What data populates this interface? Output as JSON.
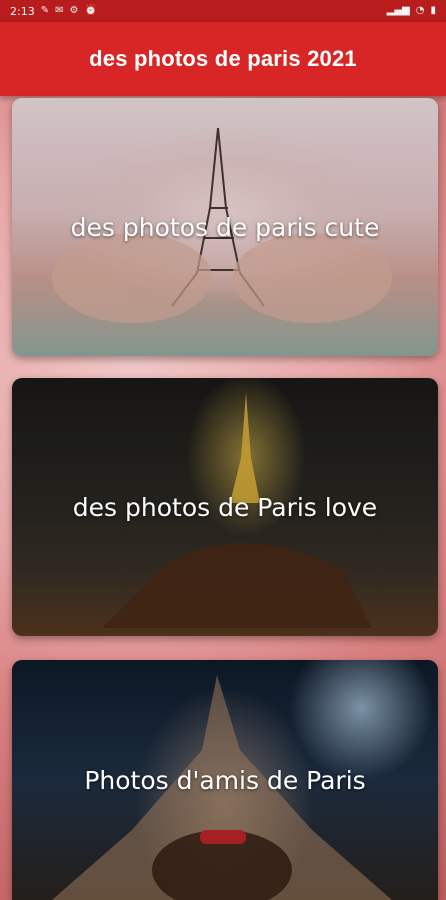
{
  "status_bar": {
    "time": "2:13",
    "left_icons": [
      "notification-icon",
      "mail-icon",
      "settings-icon",
      "alarm-icon"
    ],
    "right_icons": [
      "signal-icon",
      "wifi-icon",
      "battery-icon"
    ]
  },
  "app_bar": {
    "title": "des photos de paris 2021"
  },
  "cards": [
    {
      "label": "des photos de paris cute",
      "image": "eiffel-tower-in-hands-photo"
    },
    {
      "label": "des photos de Paris love",
      "image": "eiffel-tower-night-photo"
    },
    {
      "label": "Photos d'amis de Paris",
      "image": "eiffel-tower-from-below-photo"
    }
  ],
  "colors": {
    "status_bar": "#b81c1c",
    "app_bar": "#d82626",
    "title_text": "#ffffff"
  }
}
